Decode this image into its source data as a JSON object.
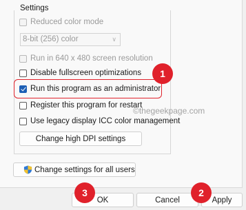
{
  "settings": {
    "group_label": "Settings",
    "reduced_color_mode": "Reduced color mode",
    "color_select_value": "8-bit (256) color",
    "run_640": "Run in 640 x 480 screen resolution",
    "disable_fullscreen": "Disable fullscreen optimizations",
    "run_as_admin": "Run this program as an administrator",
    "register_restart": "Register this program for restart",
    "legacy_icc": "Use legacy display ICC color management",
    "high_dpi_button": "Change high DPI settings"
  },
  "change_all_users_button": "Change settings for all users",
  "watermark": "©thegeekpage.com",
  "footer": {
    "ok": "OK",
    "cancel": "Cancel",
    "apply": "Apply"
  },
  "markers": [
    "1",
    "2",
    "3"
  ],
  "colors": {
    "accent": "#1d5fb5",
    "marker": "#e0212b"
  }
}
